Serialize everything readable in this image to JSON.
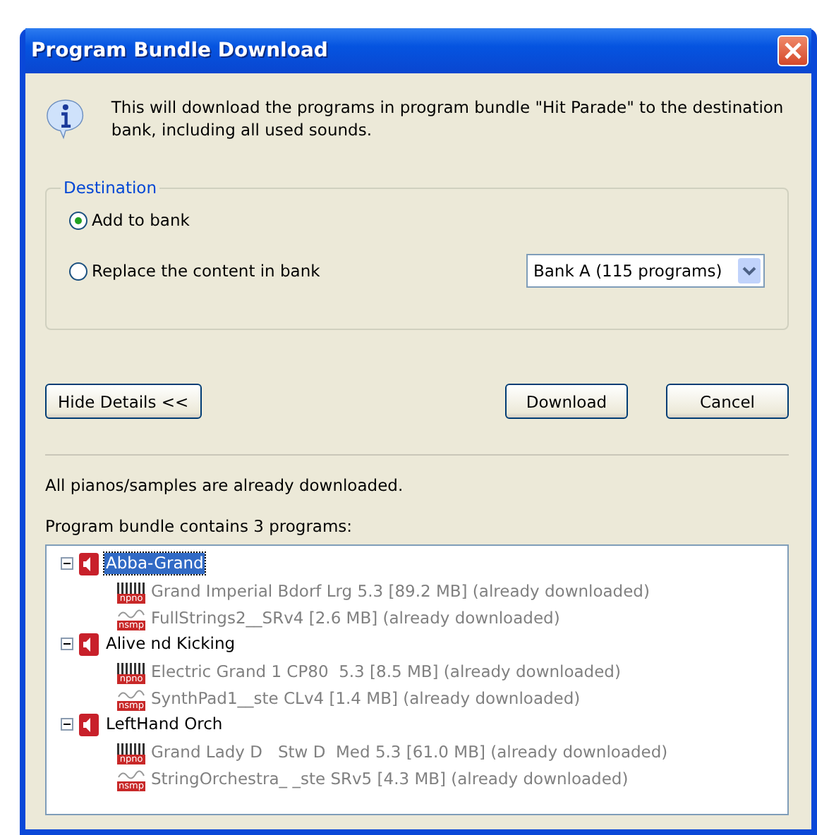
{
  "window": {
    "title": "Program Bundle Download"
  },
  "message": "This will download the programs in program bundle \"Hit Parade\" to the destination bank, including all used sounds.",
  "destination": {
    "legend": "Destination",
    "options": [
      {
        "label": "Add to bank",
        "selected": true
      },
      {
        "label": "Replace the content in bank",
        "selected": false
      }
    ],
    "bank": {
      "value": "Bank A (115 programs)"
    }
  },
  "buttons": {
    "details": "Hide Details <<",
    "download": "Download",
    "cancel": "Cancel"
  },
  "status": "All pianos/samples are already downloaded.",
  "tree_label": "Program bundle contains 3 programs:",
  "tree": [
    {
      "label": "Abba-Grand",
      "selected": true,
      "expanded": true,
      "children": [
        {
          "kind": "piano",
          "badge": "npno",
          "label": "Grand Imperial Bdorf Lrg 5.3 [89.2 MB] (already downloaded)"
        },
        {
          "kind": "sample",
          "badge": "nsmp",
          "label": "FullStrings2__SRv4 [2.6 MB] (already downloaded)"
        }
      ]
    },
    {
      "label": "Alive nd Kicking",
      "selected": false,
      "expanded": true,
      "children": [
        {
          "kind": "piano",
          "badge": "npno",
          "label": "Electric Grand 1 CP80  5.3 [8.5 MB] (already downloaded)"
        },
        {
          "kind": "sample",
          "badge": "nsmp",
          "label": "SynthPad1__ste CLv4 [1.4 MB] (already downloaded)"
        }
      ]
    },
    {
      "label": "LeftHand Orch",
      "selected": false,
      "expanded": true,
      "children": [
        {
          "kind": "piano",
          "badge": "npno",
          "label": "Grand Lady D   Stw D  Med 5.3 [61.0 MB] (already downloaded)"
        },
        {
          "kind": "sample",
          "badge": "nsmp",
          "label": "StringOrchestra_ _ste SRv5 [4.3 MB] (already downloaded)"
        }
      ]
    }
  ]
}
